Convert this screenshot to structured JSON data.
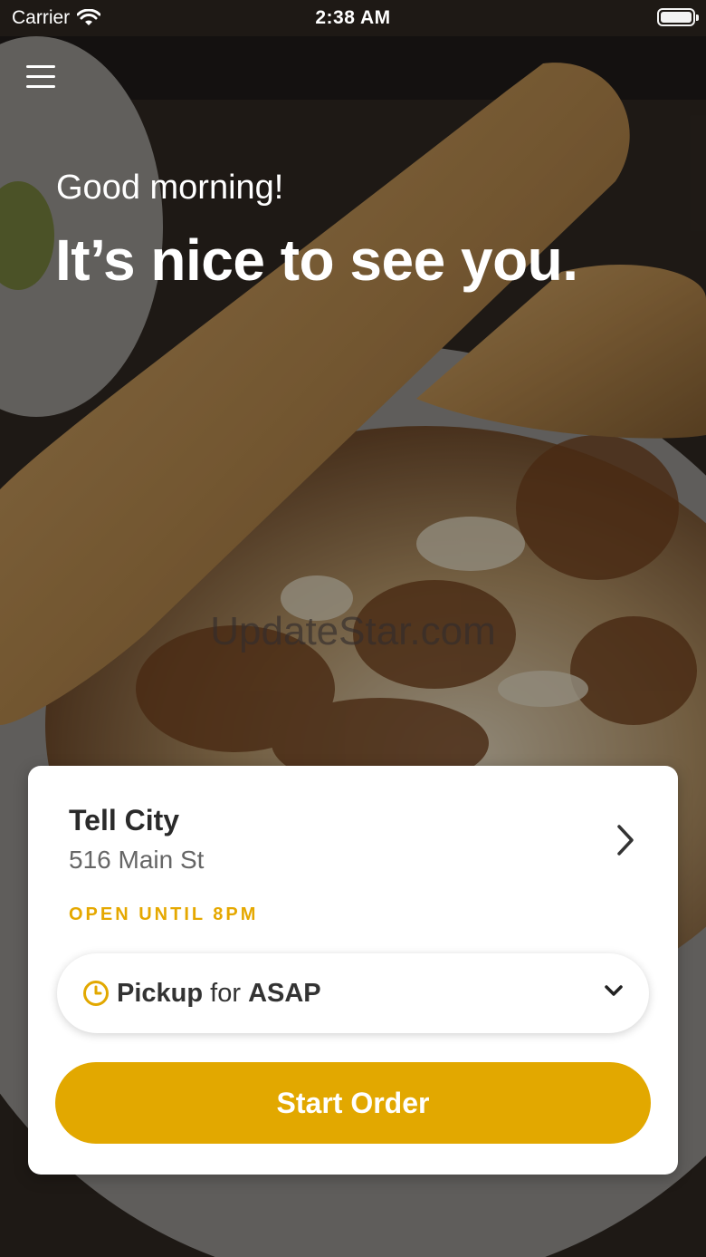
{
  "status_bar": {
    "carrier": "Carrier",
    "time": "2:38 AM",
    "icons": [
      "wifi-icon",
      "battery-icon"
    ]
  },
  "header": {
    "menu_icon": "hamburger-menu-icon",
    "greeting": "Good morning!",
    "headline": "It’s nice to see you."
  },
  "watermark": "UpdateStar.com",
  "location_card": {
    "store_name": "Tell City",
    "address": "516 Main St",
    "hours": "OPEN UNTIL 8PM",
    "pickup": {
      "mode": "Pickup",
      "connector": "for",
      "time": "ASAP",
      "icon": "clock-icon"
    },
    "cta_label": "Start Order"
  },
  "colors": {
    "accent": "#E2A800",
    "text_dark": "#2A2A2A",
    "text_muted": "#666666",
    "card_bg": "#FFFFFF"
  }
}
